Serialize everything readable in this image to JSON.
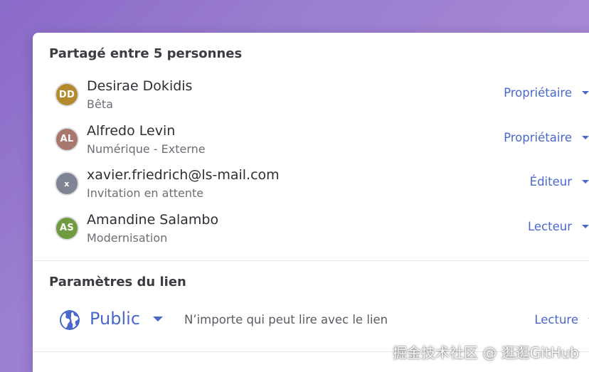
{
  "sharing": {
    "title": "Partagé entre 5 personnes",
    "people": [
      {
        "initials": "DD",
        "avatar_color": "#b38a2c",
        "name": "Desirae Dokidis",
        "subtitle": "Bêta",
        "role": "Propriétaire"
      },
      {
        "initials": "AL",
        "avatar_color": "#a8786e",
        "name": "Alfredo Levin",
        "subtitle": "Numérique - Externe",
        "role": "Propriétaire"
      },
      {
        "initials": "x",
        "avatar_color": "#7f8494",
        "name": "xavier.friedrich@ls-mail.com",
        "subtitle": "Invitation en attente",
        "role": "Éditeur"
      },
      {
        "initials": "AS",
        "avatar_color": "#6f9a3f",
        "name": "Amandine Salambo",
        "subtitle": "Modernisation",
        "role": "Lecteur"
      }
    ]
  },
  "link_settings": {
    "title": "Paramètres du lien",
    "icon": "globe-icon",
    "visibility": "Public",
    "description": "N’importe qui peut lire avec le lien",
    "role": "Lecture"
  },
  "colors": {
    "accent": "#4a68c9",
    "text_primary": "#2e2e35",
    "text_secondary": "#6e6e76"
  },
  "watermark": "掘金技术社区 @ 逛逛GitHub"
}
